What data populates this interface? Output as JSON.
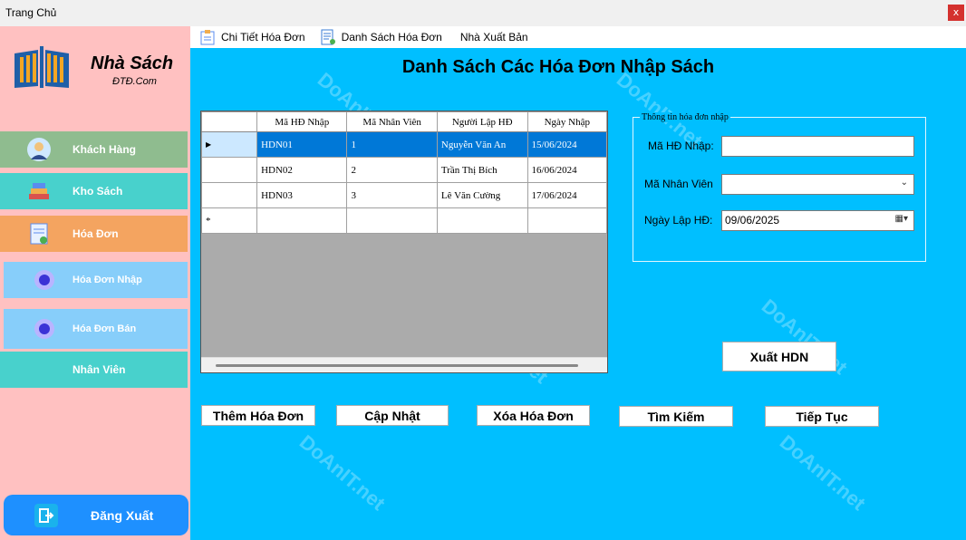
{
  "window": {
    "title": "Trang Chủ",
    "close_label": "x"
  },
  "sidebar": {
    "brand": "Nhà Sách",
    "brand_sub": "ĐTĐ.Com",
    "items": [
      {
        "label": "Khách Hàng",
        "color": "#8fbc8f"
      },
      {
        "label": "Kho Sách",
        "color": "#48d1cc"
      },
      {
        "label": "Hóa Đơn",
        "color": "#f4a460"
      },
      {
        "label": "Hóa Đơn Nhập",
        "color": "#87cefa"
      },
      {
        "label": "Hóa Đơn Bán",
        "color": "#87cefa"
      },
      {
        "label": "Nhân Viên",
        "color": "#48d1cc"
      }
    ],
    "logout_label": "Đăng Xuất"
  },
  "menubar": {
    "items": [
      "Chi Tiết Hóa Đơn",
      "Danh Sách Hóa Đơn",
      "Nhà Xuất Bản"
    ]
  },
  "main": {
    "heading": "Danh Sách Các Hóa Đơn Nhập Sách",
    "table": {
      "columns": [
        "Mã HĐ Nhập",
        "Mã Nhân Viên",
        "Người Lập HĐ",
        "Ngày Nhập"
      ],
      "rows": [
        [
          "HDN01",
          "1",
          "Nguyễn Văn An",
          "15/06/2024"
        ],
        [
          "HDN02",
          "2",
          "Trần Thị Bích",
          "16/06/2024"
        ],
        [
          "HDN03",
          "3",
          "Lê Văn Cường",
          "17/06/2024"
        ]
      ],
      "new_row_marker": "*",
      "selected_row_marker": "▶"
    },
    "group": {
      "legend": "Thông tin hóa đơn nhập",
      "ma_hd_label": "Mã HĐ Nhập:",
      "ma_hd_value": "",
      "ma_nv_label": "Mã Nhân Viên",
      "ma_nv_value": "",
      "ngay_label": "Ngày Lập HĐ:",
      "ngay_value": "09/06/2025"
    },
    "buttons": {
      "export": "Xuất HDN",
      "add": "Thêm Hóa Đơn",
      "update": "Cập Nhật",
      "delete": "Xóa Hóa Đơn",
      "search": "Tìm Kiếm",
      "next": "Tiếp Tục"
    },
    "watermark": "DoAnIT.net"
  }
}
